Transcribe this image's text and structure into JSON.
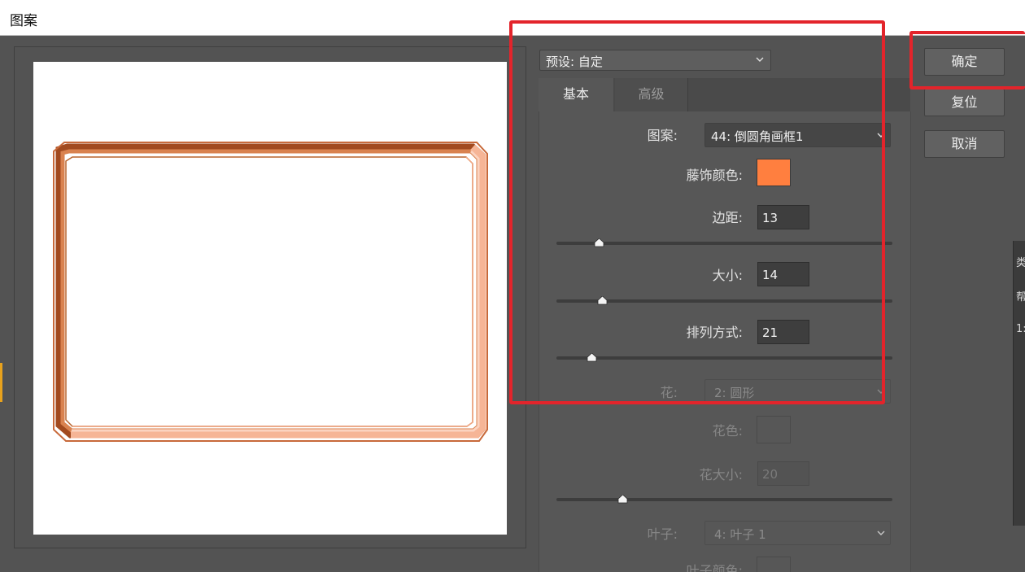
{
  "window": {
    "title": "图案"
  },
  "preset": {
    "label": "预设:",
    "value": "自定"
  },
  "tabs": {
    "basic": "基本",
    "advanced": "高级"
  },
  "fields": {
    "pattern": {
      "label": "图案:",
      "value": "44: 倒圆角画框1"
    },
    "vine_color": {
      "label": "藤饰颜色:",
      "color": "#ff7f3f"
    },
    "margin": {
      "label": "边距:",
      "value": "13",
      "slider_fraction": 0.125
    },
    "size": {
      "label": "大小:",
      "value": "14",
      "slider_fraction": 0.135
    },
    "arrangement": {
      "label": "排列方式:",
      "value": "21",
      "slider_fraction": 0.105
    },
    "flower": {
      "label": "花:",
      "value": "2: 圆形"
    },
    "flower_color": {
      "label": "花色:"
    },
    "flower_size": {
      "label": "花大小:",
      "value": "20",
      "slider_fraction": 0.195
    },
    "leaf": {
      "label": "叶子:",
      "value": "4: 叶子 1"
    },
    "leaf_color": {
      "label": "叶子颜色:"
    }
  },
  "buttons": {
    "ok": "确定",
    "reset": "复位",
    "cancel": "取消"
  },
  "edge_panel": {
    "chars": [
      "类",
      "帮",
      "1:"
    ]
  },
  "colors": {
    "annotation": "#e3242b",
    "frame_dark": "#a24a1f",
    "frame_light": "#f7b99b"
  }
}
